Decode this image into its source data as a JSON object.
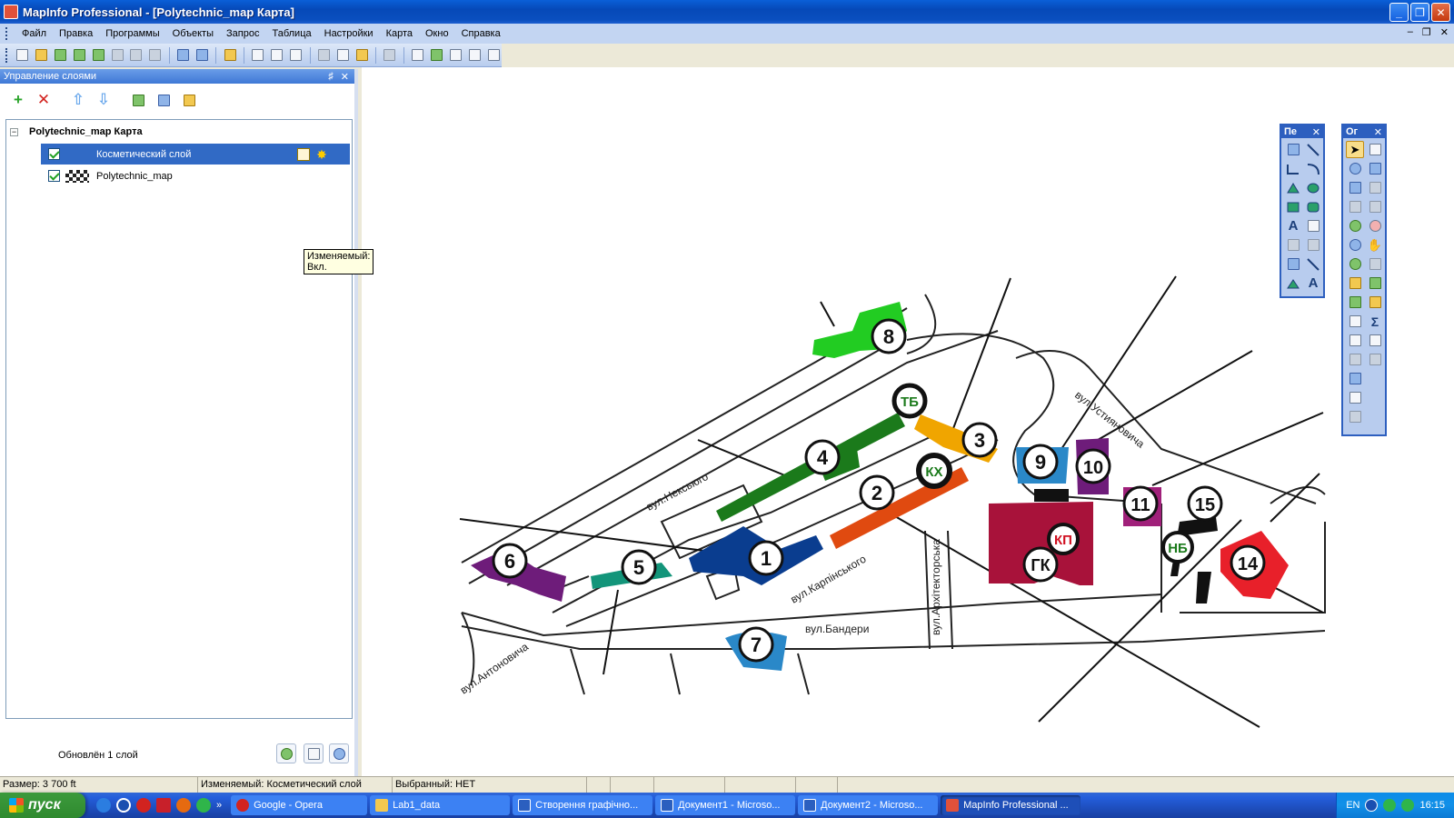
{
  "window": {
    "title": "MapInfo Professional - [Polytechnic_map Карта]",
    "minimize": "_",
    "maximize": "❐",
    "close": "✕"
  },
  "menu": {
    "items": [
      "Файл",
      "Правка",
      "Программы",
      "Объекты",
      "Запрос",
      "Таблица",
      "Настройки",
      "Карта",
      "Окно",
      "Справка"
    ],
    "mdi_minimize": "–",
    "mdi_restore": "❐",
    "mdi_close": "✕"
  },
  "layer_panel": {
    "title": "Управление слоями",
    "pin": "♯",
    "close": "✕",
    "root_label": "Polytechnic_map Карта",
    "root_expander": "−",
    "layers": [
      {
        "name": "Косметический слой",
        "visible": true,
        "selected": true
      },
      {
        "name": "Polytechnic_map",
        "visible": true,
        "selected": false
      }
    ],
    "tooltip": "Изменяемый: Вкл.",
    "status": "Обновлён 1 слой"
  },
  "map": {
    "street_labels": [
      "вул.Нексьюго",
      "вул.Карпінського",
      "вул.Архітекторська",
      "вул.Бандери",
      "вул.Антоновича",
      "вул.Устияновича"
    ],
    "markers": [
      "8",
      "ТБ",
      "3",
      "4",
      "КХ",
      "2",
      "1",
      "5",
      "6",
      "7",
      "9",
      "10",
      "11",
      "КП",
      "ГК",
      "15",
      "НБ",
      "14"
    ],
    "colors": {
      "green": "#22cc22",
      "darkgreen": "#1b7a1b",
      "orange": "#f0a500",
      "red_orange": "#e04a10",
      "navy": "#0a3d8f",
      "teal": "#13957a",
      "purple": "#6e1c7a",
      "blue": "#2a88c8",
      "crimson": "#a8123a",
      "magenta": "#a0207a",
      "red": "#e8202a"
    }
  },
  "palettes": {
    "draw_title": "Пе",
    "main_title": "Ог",
    "close": "✕"
  },
  "statusbar": {
    "size": "Размер: 3 700 ft",
    "editable": "Изменяемый: Косметический слой",
    "selected": "Выбранный: НЕТ"
  },
  "taskbar": {
    "start": "пуск",
    "more": "»",
    "tasks": [
      "Google - Opera",
      "Lab1_data",
      "Створення графічно...",
      "Документ1 - Microso...",
      "Документ2 - Microso...",
      "MapInfo Professional ..."
    ],
    "lang": "EN",
    "time": "16:15"
  }
}
